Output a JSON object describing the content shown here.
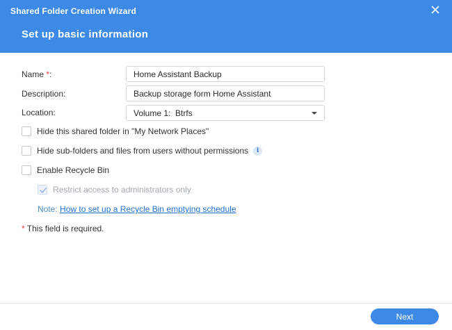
{
  "window": {
    "title": "Shared Folder Creation Wizard",
    "close_icon": "close-icon"
  },
  "step": {
    "title": "Set up basic information"
  },
  "form": {
    "name": {
      "label": "Name",
      "required_mark": "*",
      "suffix": ":",
      "value": "Home Assistant Backup"
    },
    "description": {
      "label": "Description:",
      "value": "Backup storage form Home Assistant"
    },
    "location": {
      "label": "Location:",
      "value": "Volume 1:  Btrfs"
    }
  },
  "options": {
    "hide_network_places": {
      "label": "Hide this shared folder in \"My Network Places\"",
      "checked": false
    },
    "hide_subfolders": {
      "label": "Hide sub-folders and files from users without permissions",
      "checked": false,
      "info_icon": "info-icon",
      "info_glyph": "i"
    },
    "recycle_bin": {
      "label": "Enable Recycle Bin",
      "checked": false
    },
    "restrict_admins": {
      "label": "Restrict access to administrators only",
      "checked": true,
      "disabled": true
    }
  },
  "note": {
    "label": "Note:",
    "link_text": "How to set up a Recycle Bin emptying schedule"
  },
  "required_note": {
    "mark": "*",
    "text": " This field is required."
  },
  "footer": {
    "next_label": "Next"
  },
  "colors": {
    "header_bg": "#3c8ae6",
    "accent": "#3c8ae6",
    "required": "#e0423b",
    "link": "#1f6fd0"
  }
}
